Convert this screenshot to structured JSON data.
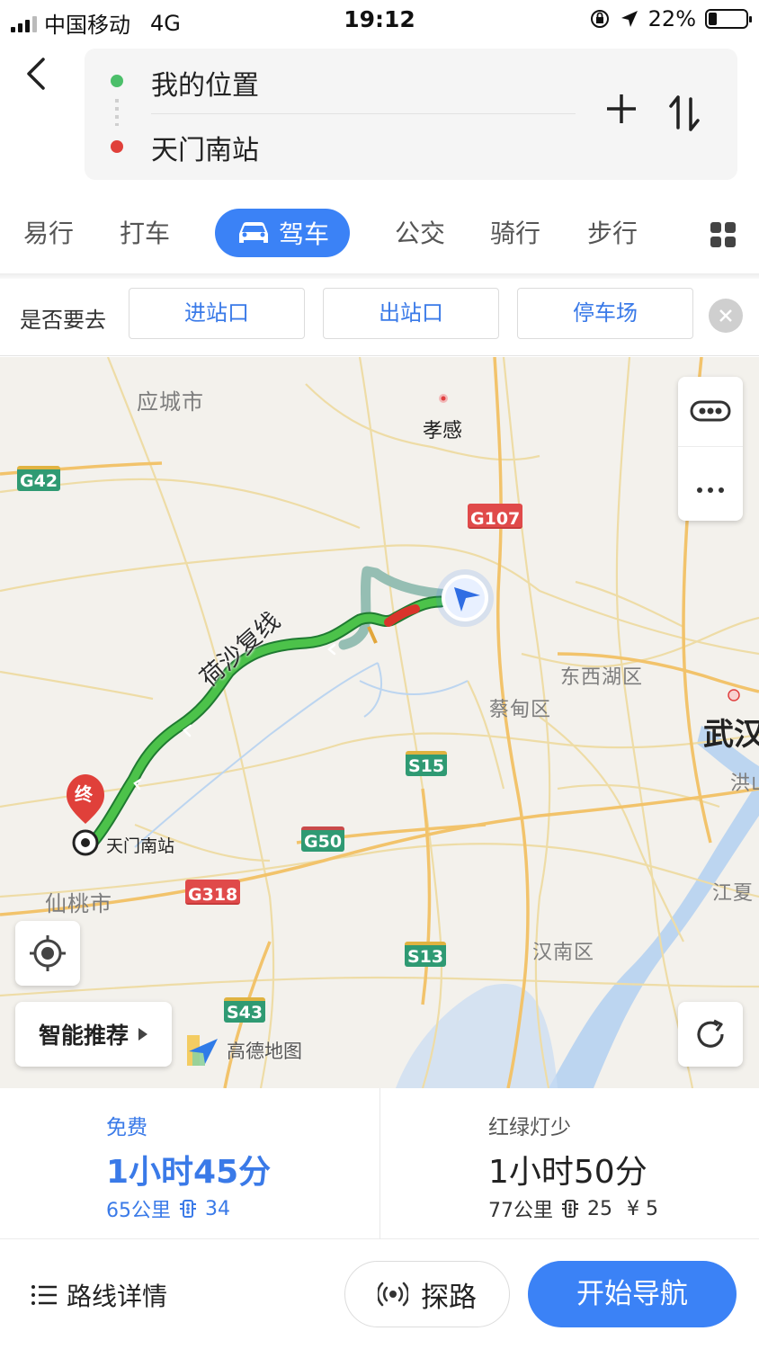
{
  "status_bar": {
    "carrier": "中国移动",
    "network": "4G",
    "time": "19:12",
    "battery": "22%"
  },
  "route": {
    "origin": "我的位置",
    "destination": "天门南站"
  },
  "modes": [
    "易行",
    "打车",
    "驾车",
    "公交",
    "骑行",
    "步行"
  ],
  "selected_mode": "驾车",
  "goto": {
    "label": "是否要去",
    "options": [
      "进站口",
      "出站口",
      "停车场"
    ]
  },
  "map": {
    "places": {
      "yingcheng": "应城市",
      "xiaogan": "孝感",
      "dongxihu": "东西湖区",
      "caidian": "蔡甸区",
      "wuhan": "武汉",
      "hong": "洪山",
      "xiantao": "仙桃市",
      "jiangxia": "江夏",
      "hannan": "汉南区",
      "station": "天门南站"
    },
    "road_name": "荷沙复线",
    "end_marker": "终",
    "highways": [
      "G42",
      "G107",
      "S15",
      "G50",
      "G318",
      "S13",
      "S43"
    ],
    "logo": "高德地图",
    "smart_recommend": "智能推荐",
    "colors": {
      "route_green": "#31a84a",
      "route_red": "#d9342b",
      "alt_route": "#8fb9ad",
      "accent": "#3b82f6"
    }
  },
  "options": [
    {
      "tag": "免费",
      "time": "1小时45分",
      "distance": "65公里",
      "lights": "34",
      "toll": ""
    },
    {
      "tag": "红绿灯少",
      "time": "1小时50分",
      "distance": "77公里",
      "lights": "25",
      "toll": "¥ 5"
    }
  ],
  "actions": {
    "details": "路线详情",
    "probe": "探路",
    "start": "开始导航"
  }
}
